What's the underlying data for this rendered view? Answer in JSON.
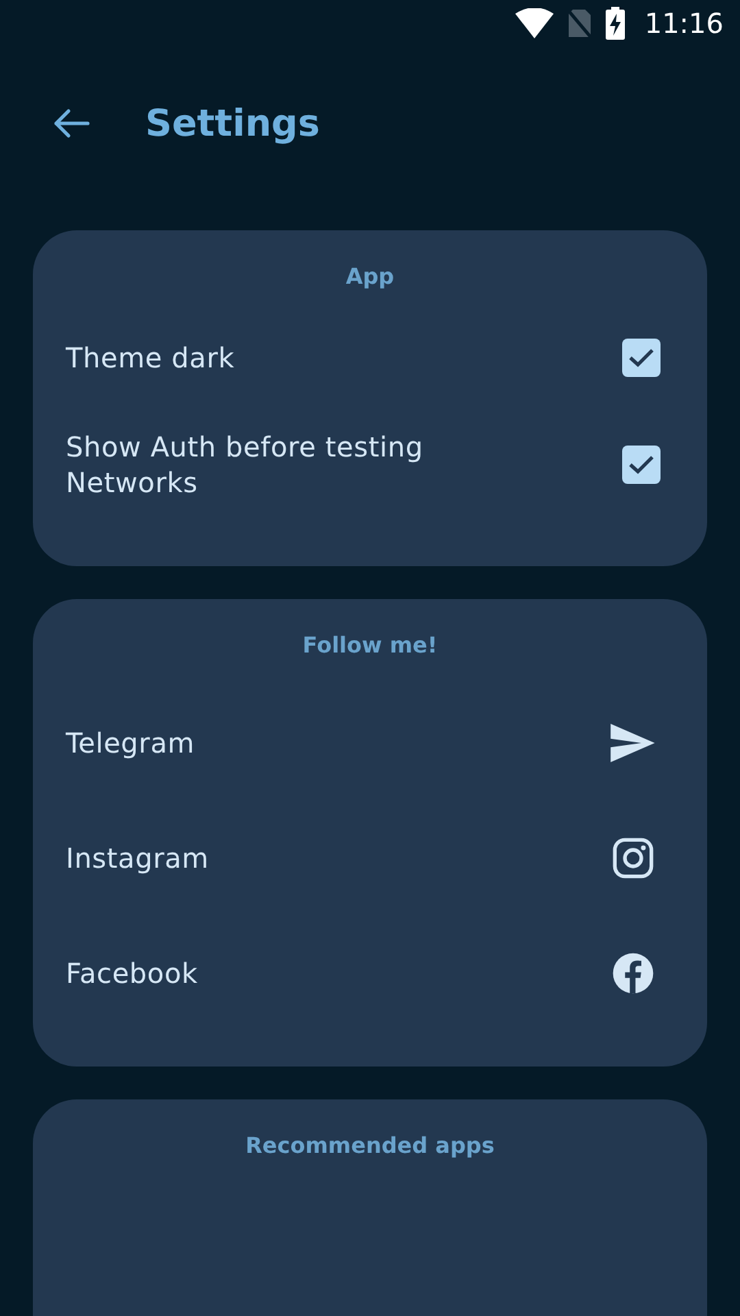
{
  "status_bar": {
    "time": "11:16"
  },
  "header": {
    "title": "Settings"
  },
  "sections": [
    {
      "title": "App",
      "items": [
        {
          "kind": "checkbox",
          "label": "Theme dark",
          "checked": true
        },
        {
          "kind": "checkbox",
          "label": "Show Auth before testing Networks",
          "checked": true
        }
      ]
    },
    {
      "title": "Follow me!",
      "items": [
        {
          "kind": "link",
          "label": "Telegram"
        },
        {
          "kind": "link",
          "label": "Instagram"
        },
        {
          "kind": "link",
          "label": "Facebook"
        }
      ]
    },
    {
      "title": "Recommended apps"
    }
  ]
}
